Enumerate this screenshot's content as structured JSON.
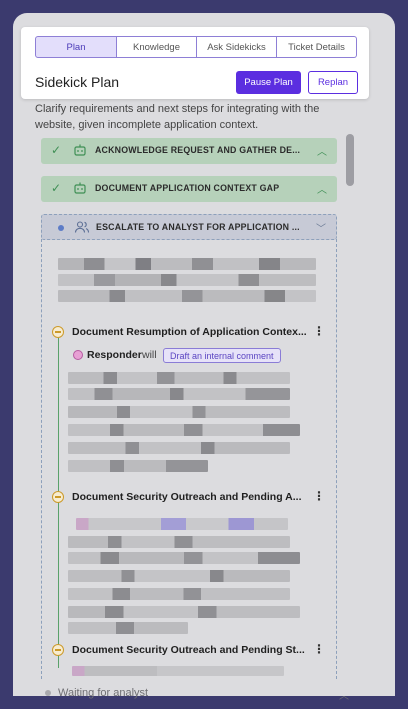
{
  "tabs": [
    {
      "label": "Plan",
      "active": true
    },
    {
      "label": "Knowledge",
      "active": false
    },
    {
      "label": "Ask Sidekicks",
      "active": false
    },
    {
      "label": "Ticket Details",
      "active": false
    }
  ],
  "header": {
    "title": "Sidekick Plan",
    "pause_label": "Pause Plan",
    "replan_label": "Replan"
  },
  "description": "Clarify requirements and next steps for integrating with the website, given incomplete application context.",
  "steps": [
    {
      "label": "ACKNOWLEDGE REQUEST AND GATHER DE...",
      "status": "done"
    },
    {
      "label": "DOCUMENT APPLICATION CONTEXT GAP",
      "status": "done"
    },
    {
      "label": "ESCALATE TO ANALYST FOR APPLICATION ...",
      "status": "active"
    }
  ],
  "substeps": [
    {
      "title": "Document Resumption of Application Contex..."
    },
    {
      "title": "Document Security Outreach and Pending A..."
    },
    {
      "title": "Document Security Outreach and Pending St..."
    }
  ],
  "responder": {
    "name": "Responder",
    "verb": "will",
    "action": "Draft an internal comment"
  },
  "footer": {
    "waiting": "Waiting for analyst"
  },
  "colors": {
    "accent": "#5b2ee0",
    "done": "#b6d1ba",
    "active": "#c7cad6"
  }
}
